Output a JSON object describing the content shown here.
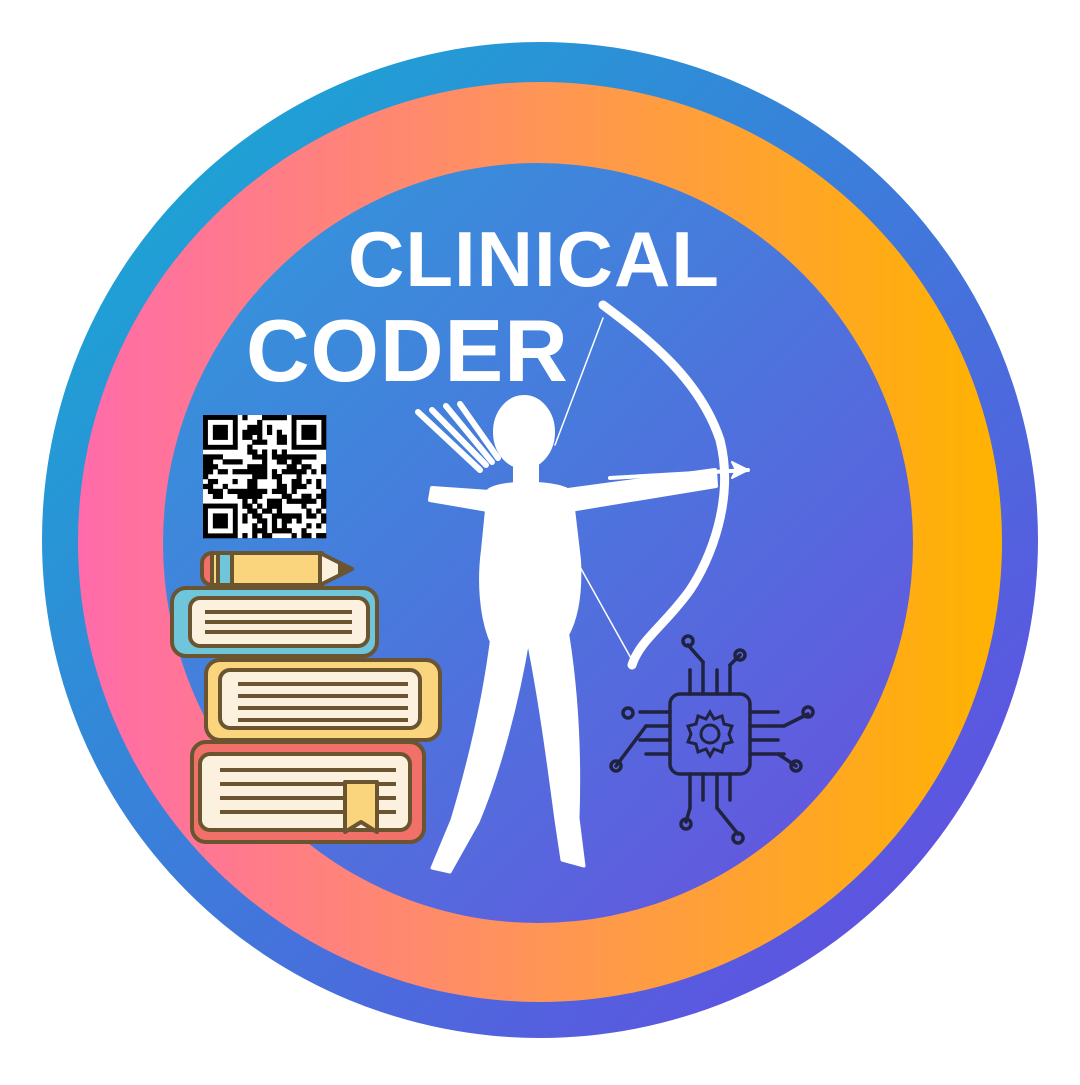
{
  "badge": {
    "title_line_1": "CLINICAL",
    "title_line_2": "CODER"
  },
  "colors": {
    "outer_ring_start": "#12B0D2",
    "outer_ring_end": "#6A45E3",
    "middle_ring_left": "#FF6BAA",
    "middle_ring_mid": "#FF9556",
    "middle_ring_right": "#FFB300",
    "inner_disc_start": "#2E9BDA",
    "inner_disc_end": "#6A4FDF",
    "silhouette": "#FFFFFF",
    "book_blue": "#6FC5DA",
    "book_yellow": "#FBD57E",
    "book_red": "#F2706A",
    "page_cream": "#FBF1DE",
    "outline": "#6B5430",
    "chip_line": "#1F2340"
  },
  "icons": [
    "qr-code-icon",
    "books-icon",
    "pencil-icon",
    "archer-silhouette-icon",
    "circuit-chip-icon",
    "gear-icon"
  ]
}
